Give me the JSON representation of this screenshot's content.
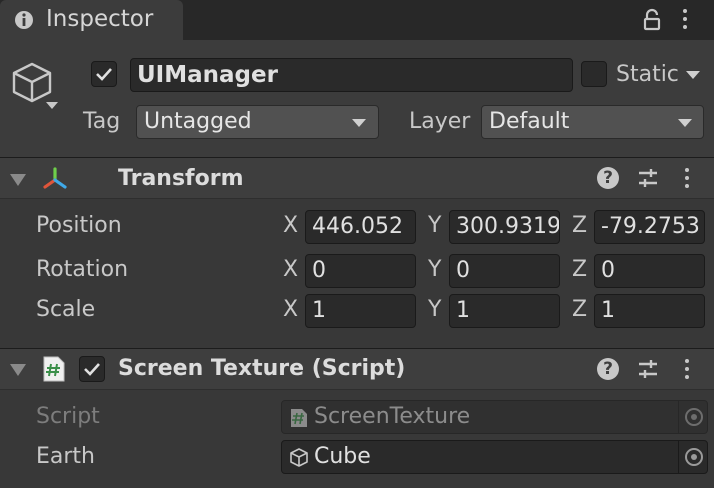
{
  "window": {
    "tab_title": "Inspector"
  },
  "gameobject": {
    "active": true,
    "name": "UIManager",
    "static_label": "Static",
    "static_checked": false,
    "tag_label": "Tag",
    "tag_value": "Untagged",
    "layer_label": "Layer",
    "layer_value": "Default"
  },
  "transform": {
    "title": "Transform",
    "position": {
      "label": "Position",
      "x": "446.052",
      "y": "300.9319",
      "z": "-79.2753"
    },
    "rotation": {
      "label": "Rotation",
      "x": "0",
      "y": "0",
      "z": "0"
    },
    "scale": {
      "label": "Scale",
      "x": "1",
      "y": "1",
      "z": "1"
    },
    "axes": {
      "x": "X",
      "y": "Y",
      "z": "Z"
    }
  },
  "screen_texture": {
    "enabled": true,
    "title": "Screen Texture (Script)",
    "script_label": "Script",
    "script_value": "ScreenTexture",
    "earth_label": "Earth",
    "earth_value": "Cube"
  },
  "colors": {
    "background": "#383838",
    "field_bg": "#2a2a2a",
    "script_icon": "#3b8f4a",
    "transform_icon_red": "#e0553a",
    "transform_icon_green": "#6fcf4a",
    "transform_icon_blue": "#3fa9e8"
  },
  "icons": {
    "tab": "info-icon",
    "lock": "lock-icon",
    "menu": "kebab-menu-icon",
    "gameobject": "cube-icon",
    "transform": "transform-axes-icon",
    "script": "csharp-script-icon",
    "help": "help-icon",
    "presets": "presets-icon",
    "object_picker": "object-picker-icon",
    "mesh": "mesh-cube-icon"
  }
}
